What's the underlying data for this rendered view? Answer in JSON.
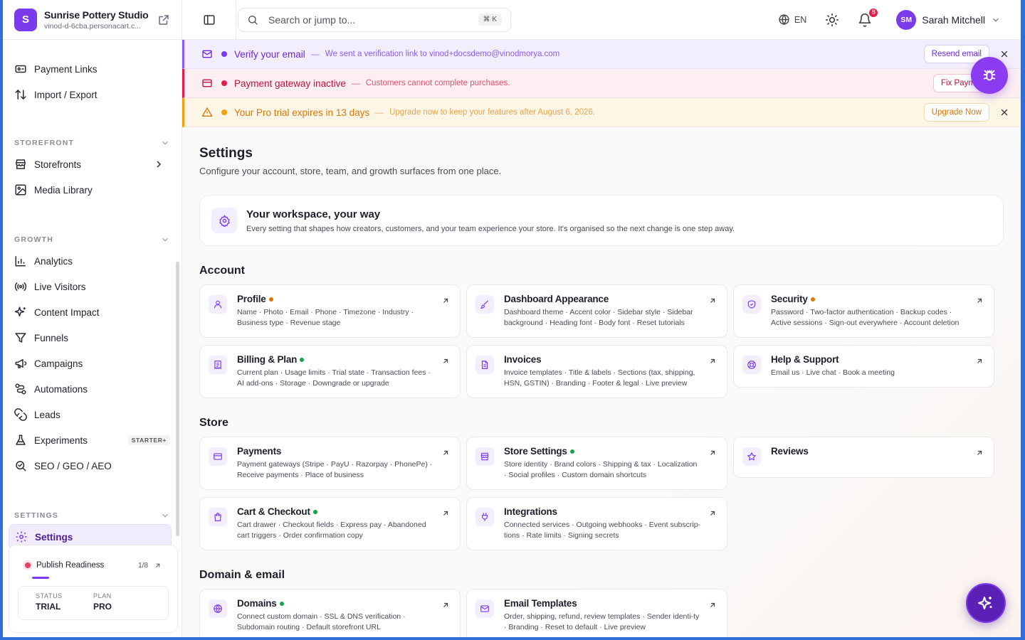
{
  "org": {
    "initial": "S",
    "name": "Sunrise Pottery Studio",
    "subdomain": "vinod-d-6cba.personacart.c..."
  },
  "nav_top": [
    {
      "id": "payment-links",
      "label": "Payment Links",
      "icon": "link-card-icon"
    },
    {
      "id": "import-export",
      "label": "Import / Export",
      "icon": "arrows-up-down-icon"
    }
  ],
  "sections": {
    "storefront": "STOREFRONT",
    "growth": "GROWTH",
    "settings": "SETTINGS"
  },
  "nav_storefront": [
    {
      "id": "storefronts",
      "label": "Storefronts",
      "icon": "store-icon"
    },
    {
      "id": "media-library",
      "label": "Media Library",
      "icon": "image-icon"
    }
  ],
  "nav_growth": [
    {
      "id": "analytics",
      "label": "Analytics",
      "icon": "bar-chart-icon"
    },
    {
      "id": "live-visitors",
      "label": "Live Visitors",
      "icon": "radio-waves-icon"
    },
    {
      "id": "content-impact",
      "label": "Content Impact",
      "icon": "sparkle-icon"
    },
    {
      "id": "funnels",
      "label": "Funnels",
      "icon": "funnel-icon"
    },
    {
      "id": "campaigns",
      "label": "Campaigns",
      "icon": "megaphone-icon"
    },
    {
      "id": "automations",
      "label": "Automations",
      "icon": "workflow-icon"
    },
    {
      "id": "leads",
      "label": "Leads",
      "icon": "magnet-icon"
    },
    {
      "id": "experiments",
      "label": "Experiments",
      "icon": "flask-icon",
      "badge": "STARTER+"
    },
    {
      "id": "seo",
      "label": "SEO / GEO / AEO",
      "icon": "search-check-icon"
    }
  ],
  "nav_settings": [
    {
      "id": "settings",
      "label": "Settings",
      "icon": "gear-icon"
    }
  ],
  "readiness": {
    "label": "Publish Readiness",
    "count": "1/8",
    "progress": 0.125,
    "status_label": "STATUS",
    "status_value": "TRIAL",
    "plan_label": "PLAN",
    "plan_value": "PRO"
  },
  "topbar": {
    "search_placeholder": "Search or jump to...",
    "shortcut": "⌘ K",
    "language": "EN",
    "notifications": "8",
    "user_initials": "SM",
    "user_name": "Sarah Mitchell"
  },
  "banners": {
    "verify": {
      "title": "Verify your email",
      "sep": "—",
      "message": "We sent a verification link to vinod+docsdemo@vinodmorya.com",
      "button": "Resend email"
    },
    "payment": {
      "title": "Payment gateway inactive",
      "sep": "—",
      "message": "Customers cannot complete purchases.",
      "button": "Fix Payments"
    },
    "trial": {
      "title": "Your Pro trial expires in 13 days",
      "sep": "—",
      "message": "Upgrade now to keep your features after August 6, 2026.",
      "button": "Upgrade Now"
    }
  },
  "page": {
    "title": "Settings",
    "subtitle": "Configure your account, store, team, and growth surfaces from one place.",
    "workspace_title": "Your workspace, your way",
    "workspace_sub": "Every setting that shapes how creators, customers, and your team experience your store. It's organised so the next change is one step away."
  },
  "groups": {
    "account": {
      "title": "Account",
      "cards": [
        {
          "title": "Profile",
          "dot": "orange",
          "desc": "Name · Photo · Email · Phone · Timezone · Industry · Business type · Revenue stage",
          "icon": "user-icon"
        },
        {
          "title": "Dashboard Appearance",
          "dot": "",
          "desc": "Dashboard theme · Accent color · Sidebar style · Sidebar background · Heading font · Body font · Reset tutorials",
          "icon": "paintbrush-icon"
        },
        {
          "title": "Security",
          "dot": "orange",
          "desc": "Password · Two-factor authentication · Backup codes · Active sessions · Sign-out everywhere · Account deletion",
          "icon": "shield-icon"
        },
        {
          "title": "Billing & Plan",
          "dot": "green",
          "desc": "Current plan · Usage limits · Trial state · Transaction fees · AI add-ons · Storage · Downgrade or upgrade",
          "icon": "receipt-icon"
        },
        {
          "title": "Invoices",
          "dot": "",
          "desc": "Invoice templates · Title & labels · Sections (tax, shipping, HSN, GSTIN) · Branding · Footer & legal · Live preview",
          "icon": "document-icon"
        },
        {
          "title": "Help & Support",
          "dot": "",
          "desc": "Email us · Live chat · Book a meeting",
          "icon": "lifebuoy-icon"
        }
      ]
    },
    "store": {
      "title": "Store",
      "cards": [
        {
          "title": "Payments",
          "dot": "",
          "desc": "Payment gateways (Stripe · PayU · Razorpay · PhonePe) · Receive payments · Place of business",
          "icon": "credit-card-icon"
        },
        {
          "title": "Store Settings",
          "dot": "green",
          "desc": "Store identity · Brand colors · Shipping & tax · Localization · Social profiles · Custom domain shortcuts",
          "icon": "store-icon"
        },
        {
          "title": "Reviews",
          "dot": "",
          "desc": "",
          "icon": "star-icon"
        },
        {
          "title": "Cart & Checkout",
          "dot": "green",
          "desc": "Cart drawer · Checkout fields · Express pay · Abandoned cart triggers · Order confirmation copy",
          "icon": "shopping-bag-icon"
        },
        {
          "title": "Integrations",
          "dot": "",
          "desc": "Connected services · Outgoing webhooks · Event subscrip-tions · Rate limits · Signing secrets",
          "icon": "plug-icon"
        }
      ]
    },
    "domain": {
      "title": "Domain & email",
      "cards": [
        {
          "title": "Domains",
          "dot": "green",
          "desc": "Connect custom domain · SSL & DNS verification · Subdomain routing · Default storefront URL",
          "icon": "globe-icon"
        },
        {
          "title": "Email Templates",
          "dot": "",
          "desc": "Order, shipping, refund, review templates · Sender identi-ty · Branding · Reset to default · Live preview",
          "icon": "mail-icon"
        }
      ]
    }
  }
}
